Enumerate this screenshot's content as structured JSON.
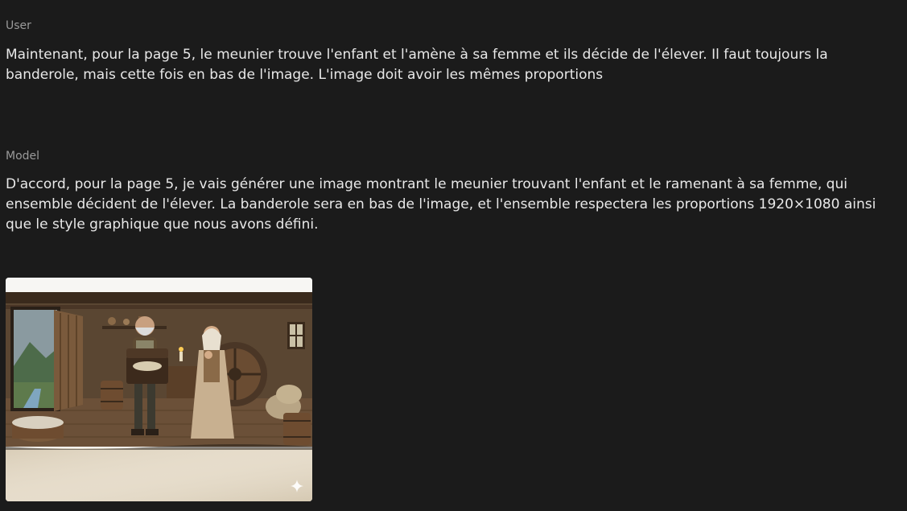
{
  "conversation": [
    {
      "role": "User",
      "text": "Maintenant, pour la page 5, le meunier trouve l'enfant et l'amène à sa femme et ils décide de l'élever. Il faut toujours la banderole, mais cette fois en bas de l'image. L'image doit avoir les mêmes proportions"
    },
    {
      "role": "Model",
      "text": "D'accord, pour la page 5, je vais générer une image montrant le meunier trouvant l'enfant et le ramenant à sa femme, qui ensemble décident de l'élever. La banderole sera en bas de l'image, et l'ensemble respectera les proportions 1920×1080 ainsi que le style graphique que nous avons défini."
    }
  ],
  "generated_image": {
    "sparkle_icon": "sparkle-icon"
  }
}
